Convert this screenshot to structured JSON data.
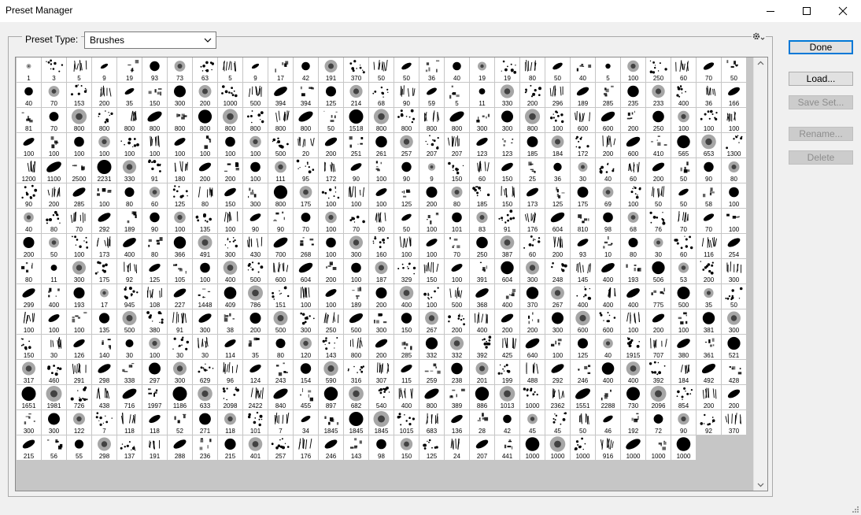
{
  "window": {
    "title": "Preset Manager",
    "minimize_icon": "minimize-icon",
    "maximize_icon": "maximize-icon",
    "close_icon": "close-icon"
  },
  "preset_type": {
    "label": "Preset Type:",
    "value": "Brushes"
  },
  "buttons": {
    "done": "Done",
    "load": "Load...",
    "save_set": "Save Set...",
    "rename": "Rename...",
    "delete": "Delete"
  },
  "colors": {
    "accent": "#0078d7",
    "grid_background": "#c6c6c6",
    "brush": "#000000"
  },
  "brush_rows": [
    [
      "1",
      "3",
      "5",
      "9",
      "19",
      "93",
      "73",
      "63",
      "5",
      "9",
      "17",
      "42",
      "191",
      "370",
      "50",
      "50",
      "36",
      "40",
      "19",
      "19",
      "80",
      "50",
      "40",
      "5",
      "100",
      "250",
      "60",
      "70",
      "50"
    ],
    [
      "40",
      "70",
      "153",
      "200",
      "35",
      "150",
      "300",
      "200",
      "1000",
      "500",
      "394",
      "394",
      "125",
      "214",
      "68",
      "90",
      "59",
      "5",
      "11",
      "330",
      "200",
      "296",
      "189",
      "285",
      "235",
      "233",
      "400",
      "36",
      "166"
    ],
    [
      "81",
      "70",
      "800",
      "800",
      "800",
      "800",
      "800",
      "800",
      "800",
      "800",
      "800",
      "800",
      "50",
      "1518",
      "800",
      "800",
      "800",
      "800",
      "300",
      "300",
      "800",
      "100",
      "600",
      "600",
      "200",
      "250",
      "100",
      "100",
      "100"
    ],
    [
      "100",
      "100",
      "100",
      "100",
      "100",
      "100",
      "100",
      "100",
      "100",
      "100",
      "500",
      "20",
      "200",
      "251",
      "261",
      "257",
      "207",
      "207",
      "123",
      "123",
      "185",
      "184",
      "172",
      "200",
      "600",
      "410",
      "565",
      "653",
      "1300"
    ],
    [
      "1200",
      "1100",
      "2500",
      "2231",
      "330",
      "91",
      "180",
      "200",
      "200",
      "100",
      "111",
      "95",
      "172",
      "90",
      "100",
      "90",
      "9",
      "150",
      "60",
      "150",
      "25",
      "36",
      "30",
      "40",
      "60",
      "200",
      "50",
      "90",
      "80"
    ],
    [
      "90",
      "200",
      "285",
      "100",
      "80",
      "60",
      "125",
      "80",
      "150",
      "300",
      "800",
      "175",
      "100",
      "100",
      "100",
      "125",
      "200",
      "80",
      "185",
      "150",
      "173",
      "125",
      "175",
      "69",
      "100",
      "50",
      "50",
      "58",
      "100"
    ],
    [
      "40",
      "80",
      "70",
      "292",
      "189",
      "90",
      "100",
      "135",
      "100",
      "90",
      "90",
      "70",
      "100",
      "70",
      "90",
      "50",
      "100",
      "101",
      "83",
      "91",
      "176",
      "604",
      "810",
      "98",
      "68",
      "76",
      "70",
      "70",
      "100"
    ],
    [
      "200",
      "50",
      "100",
      "173",
      "400",
      "80",
      "366",
      "491",
      "300",
      "430",
      "700",
      "268",
      "100",
      "300",
      "160",
      "100",
      "100",
      "70",
      "250",
      "387",
      "60",
      "200",
      "93",
      "10",
      "80",
      "30",
      "60",
      "116",
      "254"
    ],
    [
      "80",
      "11",
      "300",
      "175",
      "92",
      "125",
      "105",
      "100",
      "400",
      "500",
      "600",
      "604",
      "200",
      "100",
      "187",
      "329",
      "150",
      "100",
      "391",
      "604",
      "300",
      "248",
      "145",
      "400",
      "193",
      "506",
      "53",
      "200",
      "300"
    ],
    [
      "299",
      "400",
      "193",
      "17",
      "945",
      "108",
      "227",
      "1448",
      "409",
      "786",
      "151",
      "100",
      "100",
      "189",
      "200",
      "400",
      "100",
      "500",
      "368",
      "400",
      "370",
      "267",
      "400",
      "400",
      "400",
      "775",
      "500",
      "35",
      "50"
    ],
    [
      "100",
      "100",
      "100",
      "135",
      "500",
      "380",
      "91",
      "300",
      "38",
      "200",
      "500",
      "300",
      "250",
      "500",
      "300",
      "150",
      "267",
      "200",
      "400",
      "200",
      "200",
      "300",
      "600",
      "600",
      "100",
      "200",
      "100",
      "381",
      "300"
    ],
    [
      "150",
      "30",
      "126",
      "140",
      "30",
      "100",
      "30",
      "30",
      "114",
      "35",
      "80",
      "120",
      "143",
      "800",
      "200",
      "285",
      "332",
      "332",
      "392",
      "425",
      "640",
      "100",
      "125",
      "40",
      "1915",
      "707",
      "380",
      "361",
      "521"
    ],
    [
      "317",
      "460",
      "291",
      "298",
      "338",
      "297",
      "300",
      "629",
      "96",
      "124",
      "243",
      "154",
      "590",
      "316",
      "307",
      "115",
      "259",
      "238",
      "201",
      "199",
      "488",
      "292",
      "246",
      "400",
      "400",
      "392",
      "184",
      "492",
      "428"
    ],
    [
      "1651",
      "1981",
      "726",
      "438",
      "716",
      "1997",
      "1186",
      "633",
      "2098",
      "2422",
      "840",
      "455",
      "897",
      "682",
      "540",
      "400",
      "800",
      "389",
      "886",
      "1013",
      "1000",
      "2362",
      "1551",
      "2288",
      "730",
      "2096",
      "854",
      "200",
      "200"
    ],
    [
      "300",
      "300",
      "122",
      "7",
      "118",
      "118",
      "52",
      "271",
      "118",
      "101",
      "7",
      "34",
      "1845",
      "1845",
      "1845",
      "1015",
      "683",
      "136",
      "28",
      "42",
      "45",
      "45",
      "50",
      "46",
      "192",
      "72",
      "90",
      "92",
      "370"
    ],
    [
      "215",
      "56",
      "55",
      "298",
      "137",
      "191",
      "288",
      "236",
      "215",
      "401",
      "257",
      "176",
      "246",
      "143",
      "98",
      "150",
      "125",
      "24",
      "207",
      "441",
      "1000",
      "1000",
      "1000",
      "916",
      "1000",
      "1000",
      "1000"
    ]
  ]
}
